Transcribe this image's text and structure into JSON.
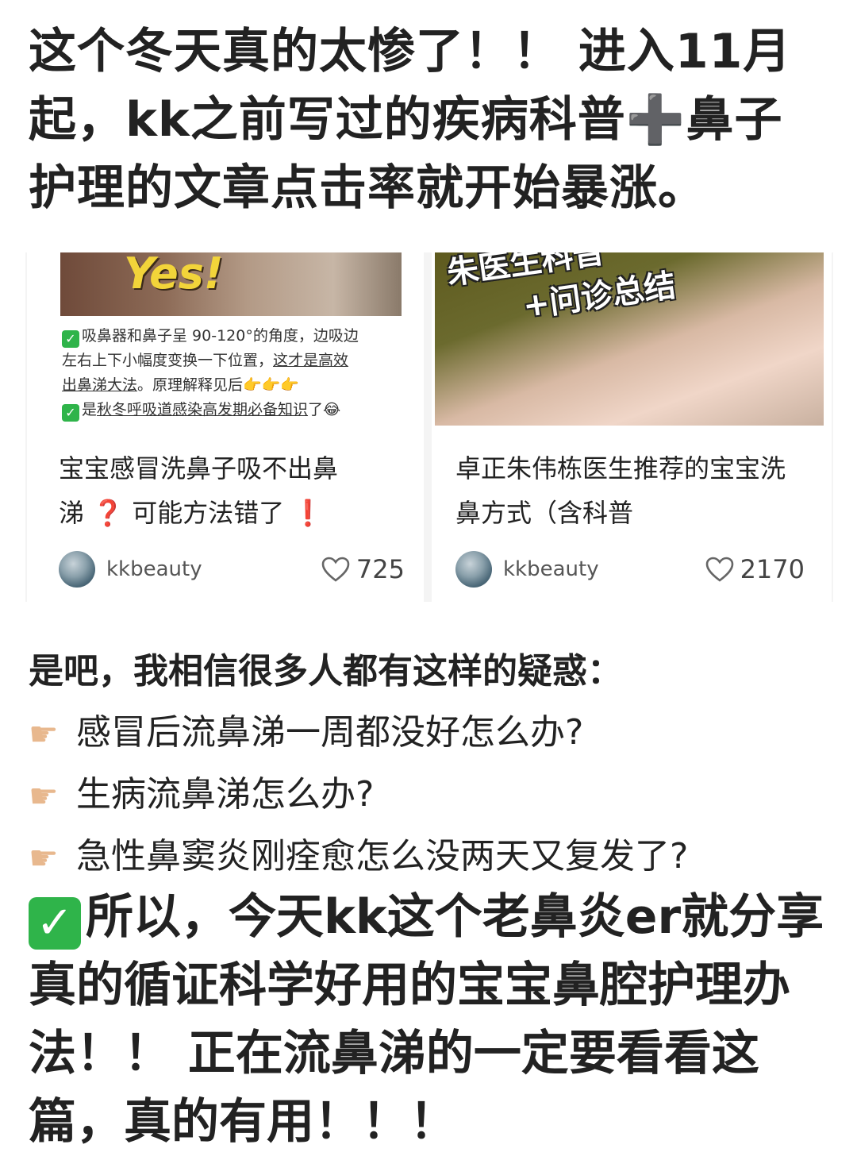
{
  "heading": "这个冬天真的太惨了！！ 进入11月起，kk之前写过的疾病科普➕鼻子护理的文章点击率就开始暴涨。",
  "cards": [
    {
      "image_text": "Yes!",
      "tips": [
        "吸鼻器和鼻子呈 90-120°的角度，边吸边",
        "左右上下小幅度变换一下位置，",
        "这才是高效",
        "出鼻涕大法",
        "。原理解释见后👉👉👉",
        "是",
        "秋冬呼吸道感染高发期必备知识",
        "了😂"
      ],
      "title_line1": "宝宝感冒洗鼻子吸不出鼻",
      "title_line2_a": "涕",
      "title_line2_mark1": "❓",
      "title_line2_b": "可能方法错了",
      "title_line2_mark2": "❗",
      "author": "kkbeauty",
      "likes": "725"
    },
    {
      "image_text_1": "朱医生科普",
      "image_text_2": "+问诊总结",
      "title": "卓正朱伟栋医生推荐的宝宝洗鼻方式（含科普",
      "author": "kkbeauty",
      "likes": "2170"
    }
  ],
  "intro": "是吧，我相信很多人都有这样的疑惑：",
  "questions": [
    "感冒后流鼻涕一周都没好怎么办?",
    "生病流鼻涕怎么办?",
    "急性鼻窦炎刚痊愈怎么没两天又复发了?"
  ],
  "conclusion": "所以，今天kk这个老鼻炎er就分享真的循证科学好用的宝宝鼻腔护理办法！！ 正在流鼻涕的一定要看看这篇，真的有用！！！",
  "icons": {
    "hand": "pointing-hand-icon",
    "check": "check-mark-icon",
    "heart": "heart-icon"
  },
  "colors": {
    "check_green": "#2fb44a",
    "alert_red": "#e02424"
  }
}
